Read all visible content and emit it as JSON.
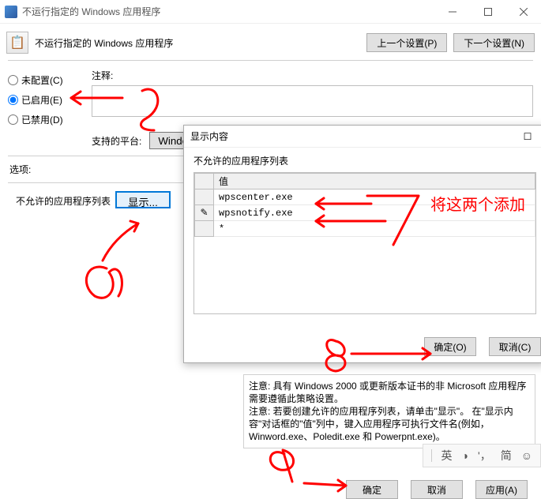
{
  "window": {
    "title": "不运行指定的 Windows 应用程序"
  },
  "header": {
    "title": "不运行指定的 Windows 应用程序",
    "prev": "上一个设置(P)",
    "next": "下一个设置(N)"
  },
  "radios": {
    "not_configured": "未配置(C)",
    "enabled": "已启用(E)",
    "disabled": "已禁用(D)",
    "selected": "enabled"
  },
  "comment_label": "注释:",
  "comment_value": "",
  "platform": {
    "label": "支持的平台:",
    "button": "Window"
  },
  "options_label": "选项:",
  "disallowed": {
    "label": "不允许的应用程序列表",
    "show_button": "显示..."
  },
  "help_text": "注意: 具有 Windows 2000 或更新版本证书的非 Microsoft 应用程序需要遵循此策略设置。\n注意: 若要创建允许的应用程序列表，请单击\"显示\"。 在\"显示内容\"对话框的\"值\"列中，键入应用程序可执行文件名(例如，Winword.exe、Poledit.exe 和 Powerpnt.exe)。",
  "bottom": {
    "ok": "确定",
    "cancel": "取消",
    "apply": "应用(A)"
  },
  "ime": {
    "chinese": "英",
    "mode": "简"
  },
  "inner_dialog": {
    "title": "显示内容",
    "label": "不允许的应用程序列表",
    "column_value": "值",
    "rows": [
      "wpscenter.exe",
      "wpsnotify.exe",
      "*"
    ],
    "ok": "确定(O)",
    "cancel": "取消(C)"
  },
  "annotations": {
    "five": "5",
    "six": "6",
    "seven": "7",
    "eight": "8",
    "nine": "9",
    "add_these": "将这两个添加"
  }
}
